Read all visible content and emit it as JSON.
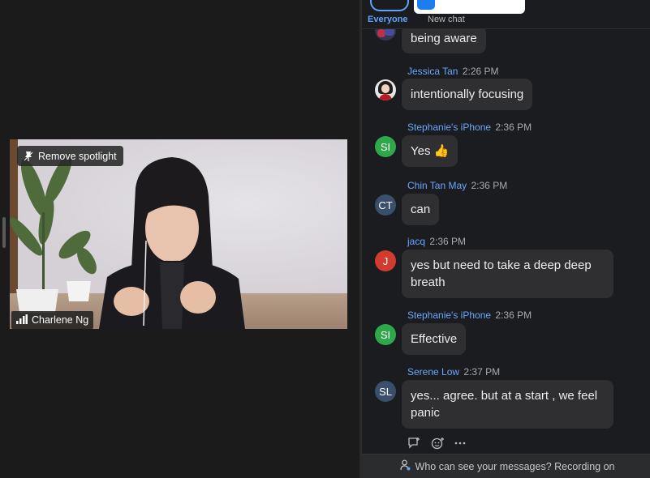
{
  "video": {
    "spotlight_button": "Remove spotlight",
    "participant_name": "Charlene Ng"
  },
  "chat_header": {
    "everyone_label": "Everyone",
    "new_chat_label": "New chat",
    "accent_color": "#5ea4ff"
  },
  "messages": [
    {
      "sender": "",
      "time": "",
      "avatar": "photo",
      "text": "being aware"
    },
    {
      "sender": "Jessica Tan",
      "time": "2:26 PM",
      "avatar": "photo",
      "text": "intentionally focusing"
    },
    {
      "sender": "Stephanie's iPhone",
      "time": "2:36 PM",
      "avatar": "SI",
      "text": "Yes 👍"
    },
    {
      "sender": "Chin Tan May",
      "time": "2:36 PM",
      "avatar": "CT",
      "text": "can"
    },
    {
      "sender": "jacq",
      "time": "2:36 PM",
      "avatar": "J",
      "text": "yes but need to take a deep deep breath"
    },
    {
      "sender": "Stephanie's iPhone",
      "time": "2:36 PM",
      "avatar": "SI",
      "text": "Effective"
    },
    {
      "sender": "Serene Low",
      "time": "2:37 PM",
      "avatar": "SL",
      "text": "yes... agree. but at a start , we feel panic"
    }
  ],
  "message_actions": [
    "reply-icon",
    "add-reaction-icon",
    "more-icon"
  ],
  "footer": {
    "text": "Who can see your messages? Recording on"
  }
}
